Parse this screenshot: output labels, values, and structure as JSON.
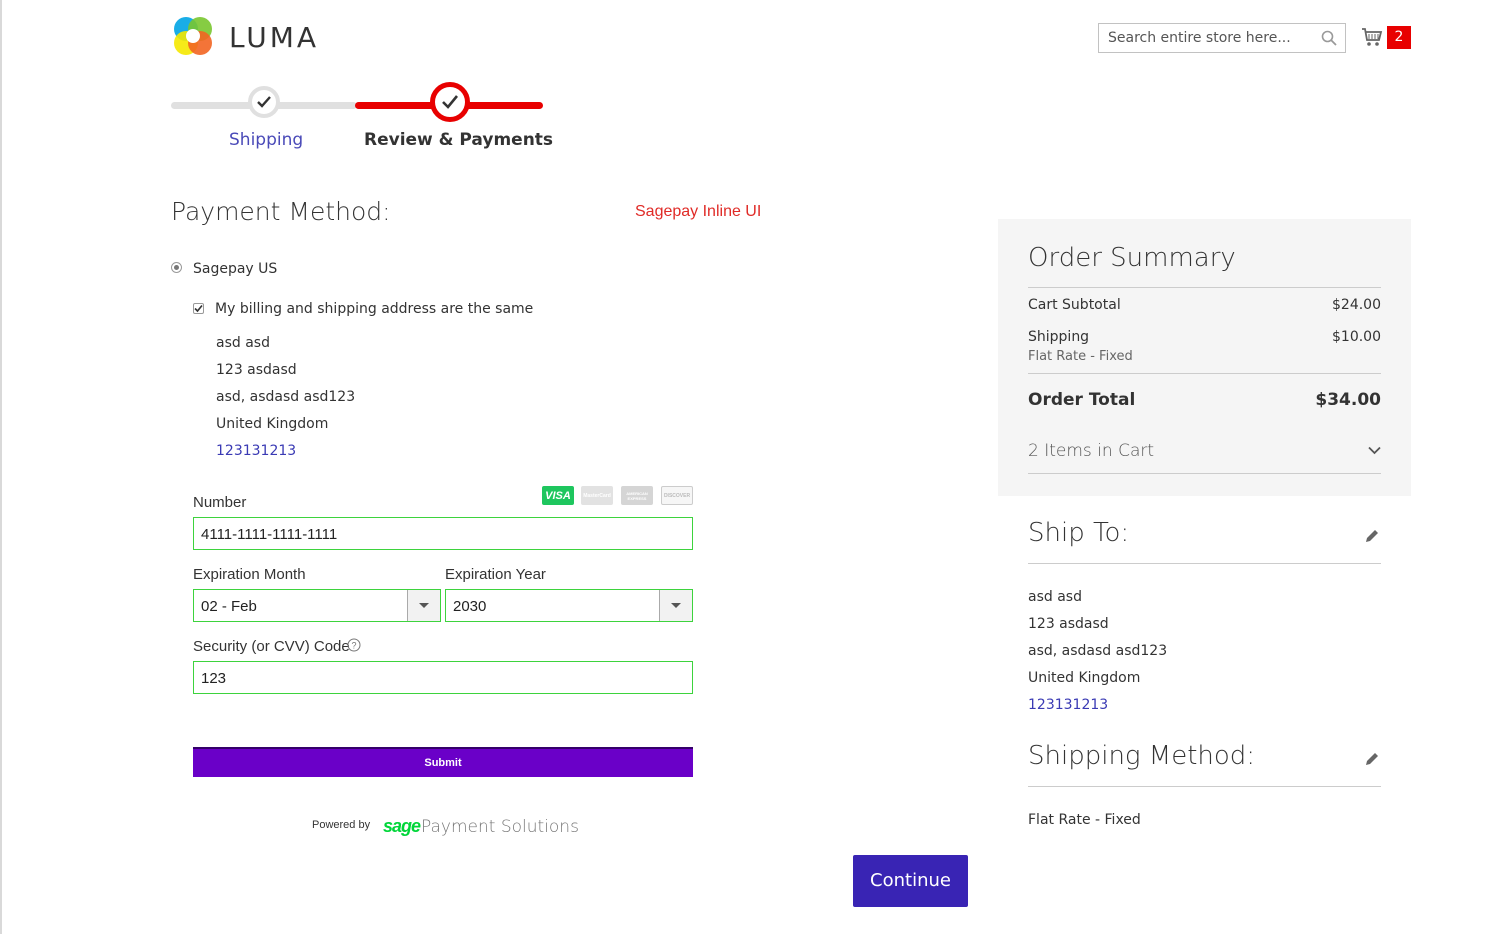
{
  "header": {
    "logo_text": "LUMA",
    "search_placeholder": "Search entire store here...",
    "cart_count": "2"
  },
  "progress": {
    "steps": [
      {
        "label": "Shipping",
        "state": "complete"
      },
      {
        "label": "Review & Payments",
        "state": "active"
      }
    ]
  },
  "payment": {
    "title": "Payment Method:",
    "ui_label": "Sagepay Inline UI",
    "method_label": "Sagepay US",
    "same_address_label": "My billing and shipping address are the same",
    "same_address_checked": true,
    "billing_address": [
      "asd asd",
      "123 asdasd",
      "asd, asdasd asd123",
      "United Kingdom"
    ],
    "billing_phone": "123131213",
    "card_logos": [
      "VISA",
      "MasterCard",
      "AMERICAN EXPRESS",
      "DISCOVER"
    ],
    "number_label": "Number",
    "number_value": "4111-1111-1111-1111",
    "exp_month_label": "Expiration Month",
    "exp_month_value": "02 - Feb",
    "exp_year_label": "Expiration Year",
    "exp_year_value": "2030",
    "cvv_label": "Security (or CVV) Code",
    "cvv_value": "123",
    "submit_label": "Submit",
    "powered_by": "Powered by",
    "sage_brand": "sage",
    "sage_suffix": "Payment Solutions",
    "continue_label": "Continue"
  },
  "summary": {
    "title": "Order Summary",
    "subtotal_label": "Cart Subtotal",
    "subtotal_value": "$24.00",
    "shipping_label": "Shipping",
    "shipping_value": "$10.00",
    "shipping_method": "Flat Rate - Fixed",
    "total_label": "Order Total",
    "total_value": "$34.00",
    "items_in_cart": "2 Items in Cart"
  },
  "ship_to": {
    "title": "Ship To:",
    "address": [
      "asd asd",
      "123 asdasd",
      "asd, asdasd asd123",
      "United Kingdom"
    ],
    "phone": "123131213"
  },
  "shipping_method": {
    "title": "Shipping Method:",
    "value": "Flat Rate - Fixed"
  },
  "colors": {
    "progress_active": "#e80000",
    "button_purple": "#3924b4",
    "submit_purple": "#6a00c8",
    "field_border": "#3dd33d",
    "sage_green": "#00d639"
  }
}
